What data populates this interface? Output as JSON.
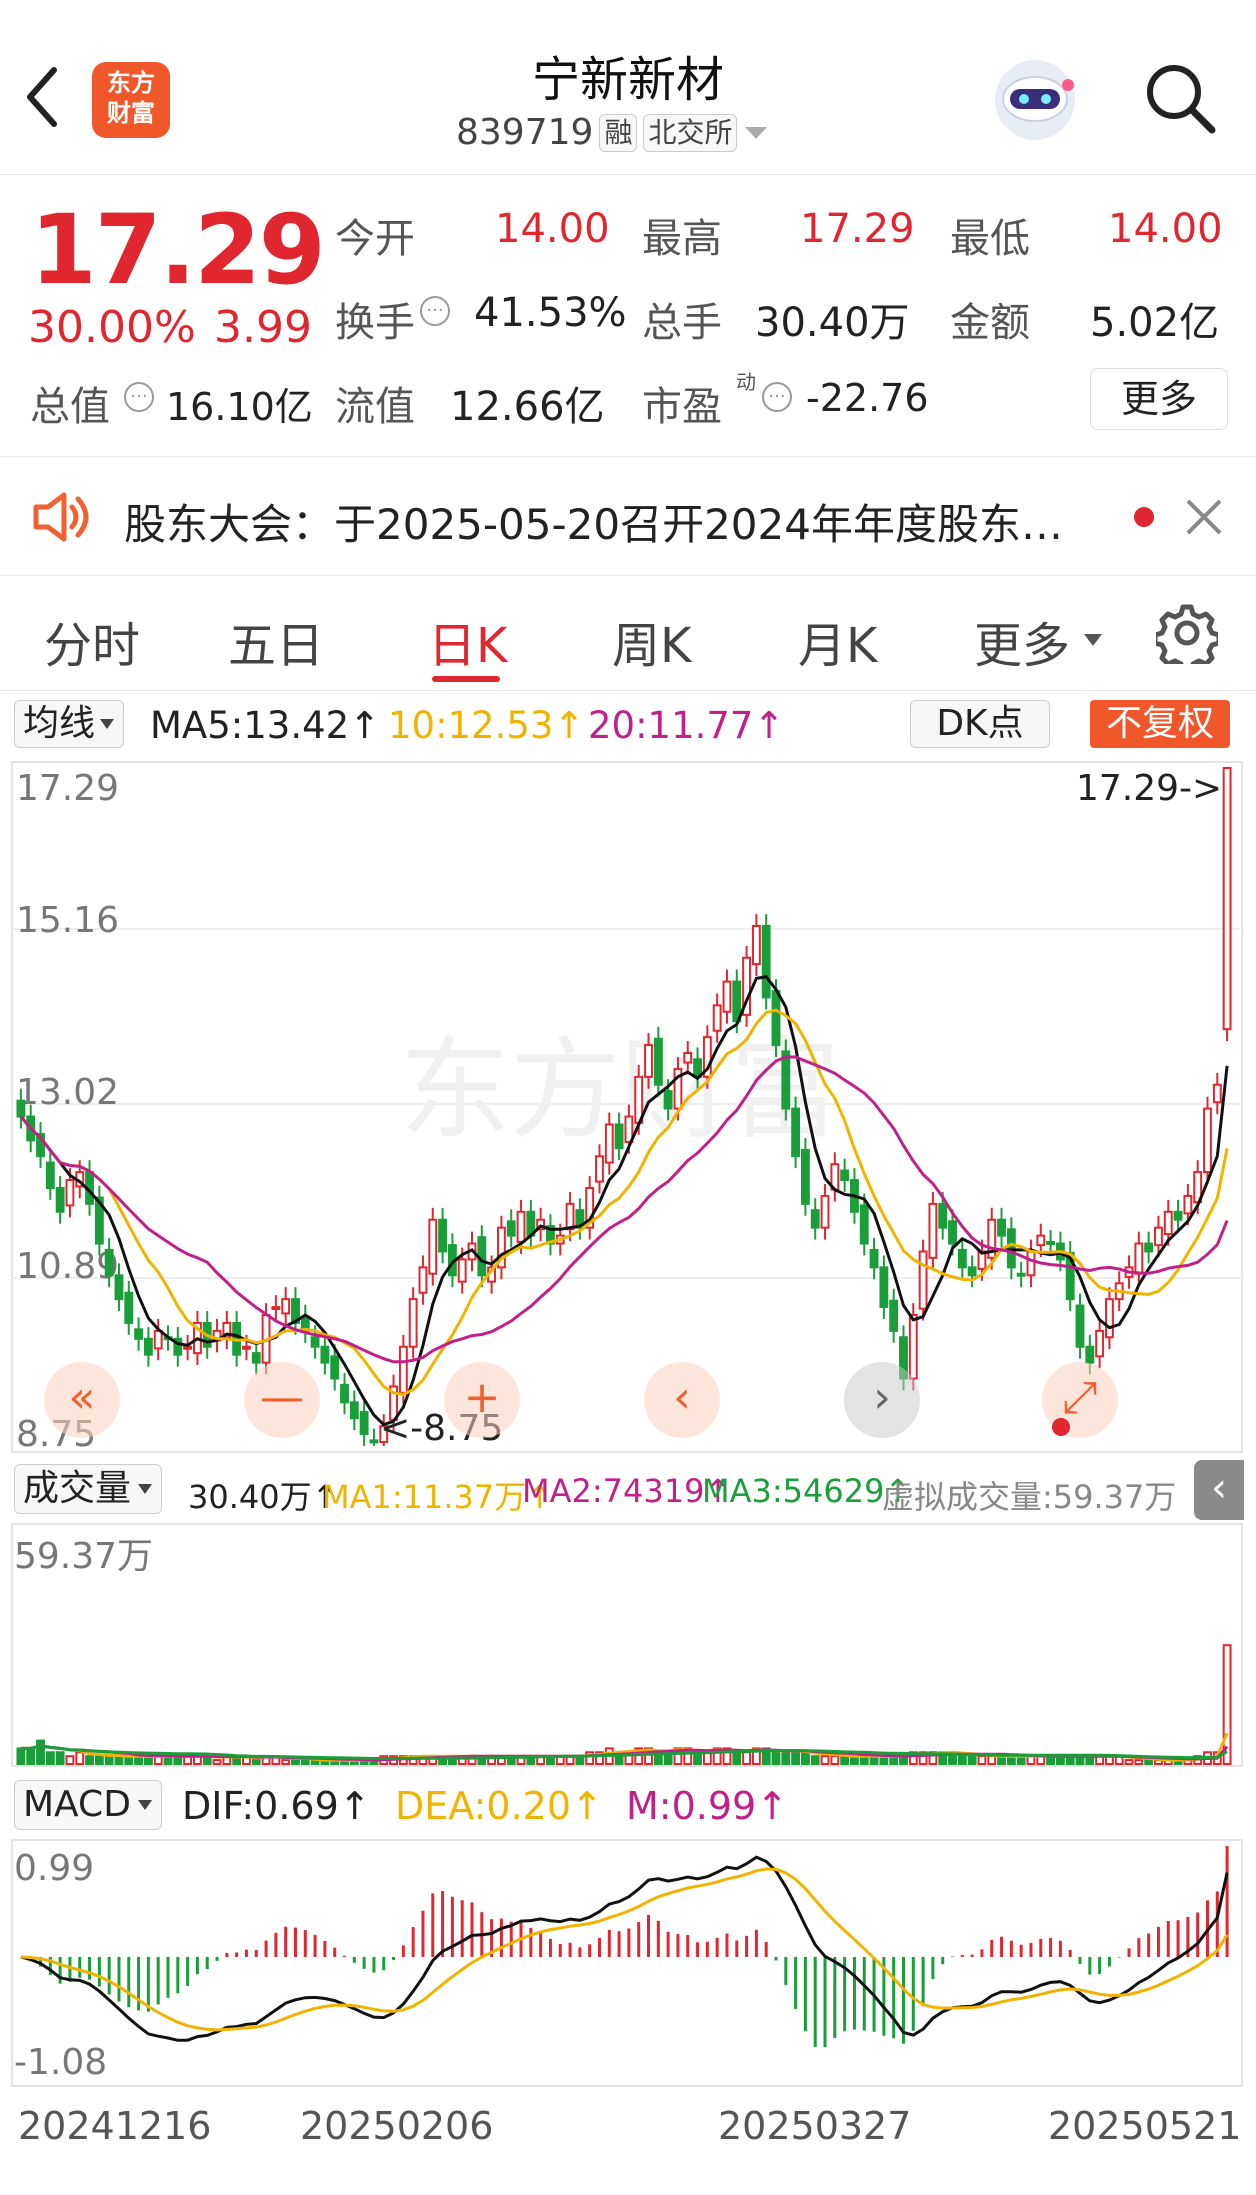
{
  "header": {
    "title": "宁新新材",
    "code": "839719",
    "tag_margin": "融",
    "tag_exchange": "北交所",
    "logo_line1": "东方",
    "logo_line2": "财富"
  },
  "quote": {
    "price": "17.29",
    "change_pct": "30.00%",
    "change_amt": "3.99",
    "open_label": "今开",
    "open": "14.00",
    "high_label": "最高",
    "high": "17.29",
    "low_label": "最低",
    "low": "14.00",
    "turnover_label": "换手",
    "turnover": "41.53%",
    "volume_label": "总手",
    "volume": "30.40万",
    "amount_label": "金额",
    "amount": "5.02亿",
    "mktcap_label": "总值",
    "mktcap": "16.10亿",
    "float_label": "流值",
    "float": "12.66亿",
    "pe_label": "市盈",
    "pe_sup": "动",
    "pe": "-22.76",
    "more_label": "更多"
  },
  "notice": {
    "text": "股东大会：于2025-05-20召开2024年年度股东…"
  },
  "tabs": [
    "分时",
    "五日",
    "日K",
    "周K",
    "月K",
    "更多"
  ],
  "ma_bar": {
    "selector": "均线",
    "ma5": "MA5:13.42↑",
    "ma10": "10:12.53↑",
    "ma20": "20:11.77↑",
    "dk": "DK点",
    "fq": "不复权"
  },
  "kline": {
    "y_labels": [
      "17.29",
      "15.16",
      "13.02",
      "10.89",
      "8.75"
    ],
    "high_marker": "17.29->",
    "low_marker": "<-8.75",
    "watermark": "东方财富"
  },
  "vol_bar": {
    "selector": "成交量",
    "vol": "30.40万↑",
    "ma1": "MA1:11.37万↑",
    "ma2": "MA2:74319↑",
    "ma3": "MA3:54629↑",
    "virtual": "虚拟成交量:59.37万",
    "y_top": "59.37万"
  },
  "macd_bar": {
    "selector": "MACD",
    "dif": "DIF:0.69↑",
    "dea": "DEA:0.20↑",
    "m": "M:0.99↑",
    "y_top": "0.99",
    "y_bottom": "-1.08"
  },
  "x_labels": [
    "20241216",
    "20250206",
    "20250327",
    "20250521"
  ],
  "fabs": [
    "«",
    "—",
    "+",
    "‹",
    "›",
    "⤢"
  ],
  "colors": {
    "up": "#e0262e",
    "down": "#1a9e3a",
    "ma5": "#111111",
    "ma10": "#f0b400",
    "ma20": "#c0208a",
    "accent": "#f06030"
  },
  "chart_data": {
    "type": "candlestick",
    "price_range": [
      8.75,
      17.29
    ],
    "closes": [
      12.9,
      12.6,
      12.4,
      12.0,
      11.7,
      12.1,
      12.2,
      11.8,
      11.3,
      10.9,
      10.6,
      10.3,
      10.1,
      9.9,
      10.2,
      10.1,
      9.9,
      10.0,
      10.3,
      10.0,
      10.2,
      10.3,
      9.9,
      10.0,
      9.8,
      10.4,
      10.5,
      10.6,
      10.3,
      10.2,
      10.0,
      9.8,
      9.6,
      9.3,
      9.1,
      8.9,
      8.8,
      9.0,
      9.5,
      10.0,
      10.6,
      11.0,
      11.6,
      11.2,
      10.9,
      11.1,
      11.3,
      10.9,
      11.0,
      11.5,
      11.4,
      11.7,
      11.4,
      11.6,
      11.3,
      11.4,
      11.8,
      11.5,
      12.0,
      12.4,
      12.8,
      12.5,
      12.9,
      13.4,
      13.8,
      13.3,
      13.0,
      13.5,
      13.7,
      13.4,
      13.9,
      14.3,
      14.6,
      14.1,
      14.9,
      15.3,
      14.4,
      13.8,
      13.0,
      12.4,
      11.8,
      11.5,
      11.9,
      12.3,
      12.1,
      11.7,
      11.3,
      11.0,
      10.5,
      10.2,
      9.6,
      10.4,
      11.2,
      11.8,
      11.5,
      11.3,
      11.0,
      10.9,
      11.2,
      11.6,
      11.4,
      11.0,
      10.9,
      11.2,
      11.4,
      11.3,
      11.1,
      10.6,
      10.0,
      9.8,
      10.2,
      10.6,
      10.8,
      11.0,
      11.3,
      11.2,
      11.5,
      11.7,
      11.6,
      11.9,
      12.2,
      13.0,
      13.3,
      17.29
    ],
    "volumes": [
      4,
      4,
      6,
      3,
      3,
      2,
      3,
      2,
      2,
      2,
      2,
      2,
      2,
      2,
      2,
      2,
      2,
      2,
      2,
      2,
      1,
      2,
      2,
      2,
      1,
      2,
      2,
      1,
      1,
      1,
      1,
      1,
      1,
      1,
      1,
      1,
      1,
      2,
      2,
      2,
      2,
      2,
      2,
      2,
      2,
      2,
      2,
      2,
      2,
      2,
      2,
      2,
      2,
      2,
      2,
      2,
      2,
      2,
      3,
      3,
      4,
      3,
      3,
      4,
      4,
      3,
      3,
      4,
      4,
      3,
      3,
      4,
      4,
      3,
      3,
      4,
      4,
      3,
      3,
      3,
      3,
      2,
      2,
      2,
      2,
      2,
      2,
      2,
      2,
      2,
      2,
      3,
      3,
      3,
      3,
      3,
      2,
      2,
      2,
      2,
      2,
      2,
      2,
      2,
      2,
      2,
      2,
      2,
      2,
      2,
      2,
      2,
      2,
      1,
      1,
      1,
      1,
      1,
      1,
      1,
      2,
      3,
      3,
      30.4
    ],
    "vol_range": [
      0,
      59.37
    ],
    "macd_range": [
      -1.08,
      0.99
    ],
    "series": [
      {
        "name": "MA5"
      },
      {
        "name": "MA10"
      },
      {
        "name": "MA20"
      }
    ]
  }
}
